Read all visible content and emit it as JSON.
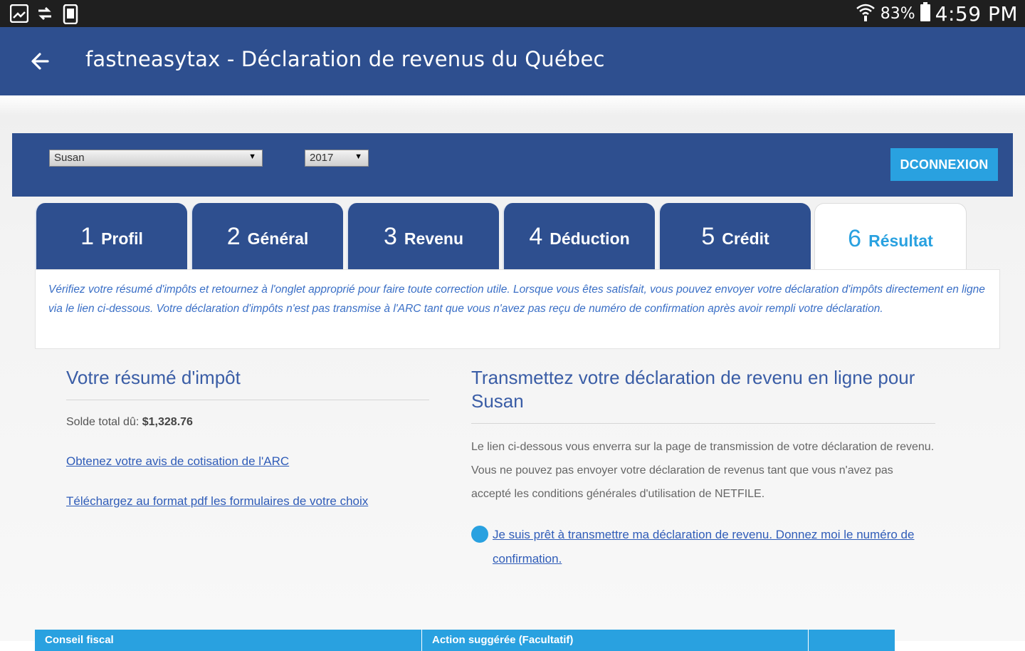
{
  "status_bar": {
    "left_icons": [
      "gallery-icon",
      "sync-icon",
      "phone-icon"
    ],
    "battery": "83%",
    "time": "4:59 PM"
  },
  "app_bar": {
    "back_icon": "arrow-left-icon",
    "title": "fastneasytax - Déclaration de revenus du Québec"
  },
  "controls": {
    "person_select": "Susan",
    "year_select": "2017",
    "logout_button": "DCONNEXION"
  },
  "tabs": [
    {
      "num": "1",
      "label": "Profil",
      "active": false
    },
    {
      "num": "2",
      "label": "Général",
      "active": false
    },
    {
      "num": "3",
      "label": "Revenu",
      "active": false
    },
    {
      "num": "4",
      "label": "Déduction",
      "active": false
    },
    {
      "num": "5",
      "label": "Crédit",
      "active": false
    },
    {
      "num": "6",
      "label": "Résultat",
      "active": true
    }
  ],
  "info_text": "Vérifiez votre résumé d'impôts et retournez à l'onglet approprié pour faire toute correction utile. Lorsque vous êtes satisfait, vous pouvez envoyer votre déclaration d'impôts directement en ligne via le lien ci-dessous. Votre déclaration d'impôts n'est pas transmise à l'ARC tant que vous n'avez pas reçu de numéro de confirmation après avoir rempli votre déclaration.",
  "summary": {
    "title": "Votre résumé d'impôt",
    "balance_label": "Solde total dû:",
    "balance_value": "$1,328.76",
    "link_assessment": "Obtenez votre avis de cotisation de l'ARC",
    "link_download": "Téléchargez au format pdf les formulaires de votre choix"
  },
  "transmit": {
    "title": "Transmettez votre déclaration de revenu en ligne pour Susan",
    "description": "Le lien ci-dessous vous enverra sur la page de transmission de votre déclaration de revenu. Vous ne pouvez pas envoyer votre déclaration de revenus tant que vous n'avez pas accepté les conditions générales d'utilisation de NETFILE.",
    "ready_link": "Je suis prêt à transmettre ma déclaration de revenu. Donnez moi le numéro de confirmation."
  },
  "bottom_table": {
    "headers": [
      "Conseil fiscal",
      "Action suggérée (Facultatif)",
      ""
    ]
  },
  "colors": {
    "primary": "#2e4f8f",
    "accent": "#29a1e0",
    "link": "#2f5cb8"
  }
}
